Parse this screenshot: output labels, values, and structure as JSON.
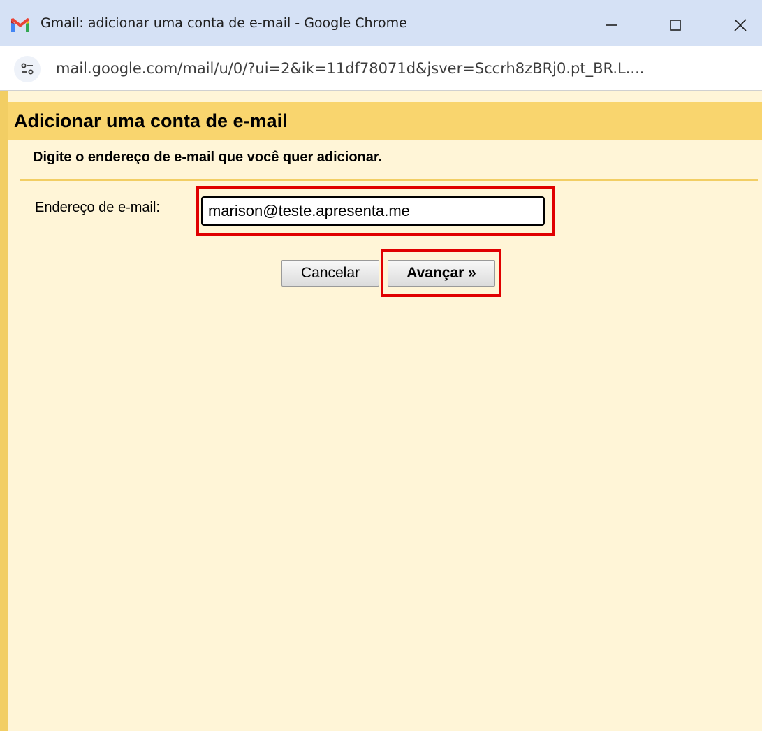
{
  "window": {
    "title": "Gmail: adicionar uma conta de e-mail - Google Chrome",
    "url": "mail.google.com/mail/u/0/?ui=2&ik=11df78071d&jsver=Sccrh8zBRj0.pt_BR.L...."
  },
  "dialog": {
    "title": "Adicionar uma conta de e-mail",
    "subtitle": "Digite o endereço de e-mail que você quer adicionar.",
    "email_label": "Endereço de e-mail:",
    "email_value": "marison@teste.apresenta.me",
    "cancel_label": "Cancelar",
    "next_label": "Avançar »"
  },
  "icons": {
    "app": "gmail-icon",
    "site_info": "site-info-icon",
    "minimize": "minimize-icon",
    "maximize": "maximize-icon",
    "close": "close-icon"
  },
  "colors": {
    "header_band": "#f9d56e",
    "page_background": "#fff5d7",
    "highlight": "#e00000",
    "titlebar": "#d5e1f5"
  }
}
